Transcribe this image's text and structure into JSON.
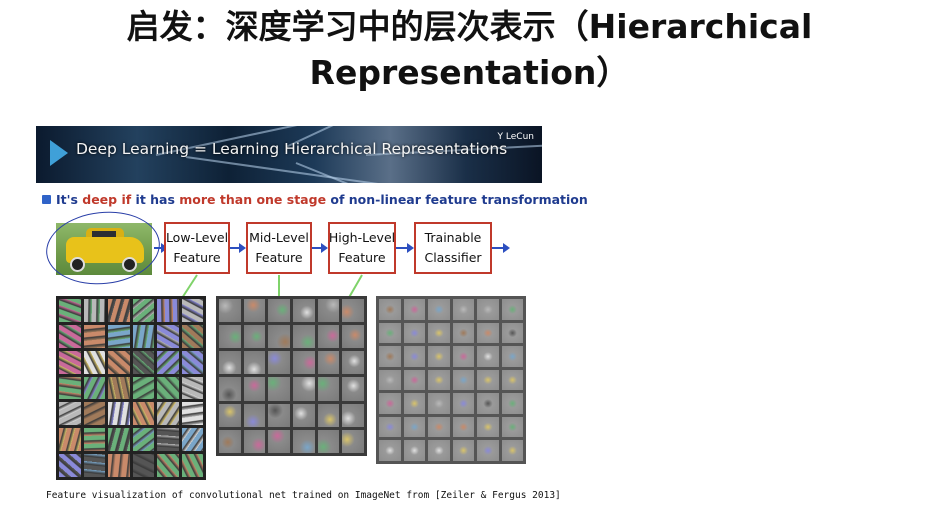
{
  "slide": {
    "title_line1": "启发：深度学习中的层次表示（Hierarchical",
    "title_line2": "Representation）"
  },
  "figure": {
    "banner_title": "Deep Learning = Learning Hierarchical Representations",
    "author": "Y LeCun",
    "bullet": {
      "part1": "It's ",
      "part2": "deep if",
      "part3": " it has ",
      "part4": "more than one stage",
      "part5": " of non-linear feature transformation"
    },
    "stages": [
      {
        "line1": "Low-Level",
        "line2": "Feature"
      },
      {
        "line1": "Mid-Level",
        "line2": "Feature"
      },
      {
        "line1": "High-Level",
        "line2": "Feature"
      },
      {
        "line1": "Trainable",
        "line2": "Classifier"
      }
    ],
    "caption": "Feature visualization of convolutional net trained on ImageNet from [Zeiler & Fergus 2013]",
    "colors": {
      "box_border": "#c0392b",
      "arrow": "#2c4fc0",
      "connector": "#7fd36a",
      "bullet_text": "#1f3b8f"
    }
  }
}
